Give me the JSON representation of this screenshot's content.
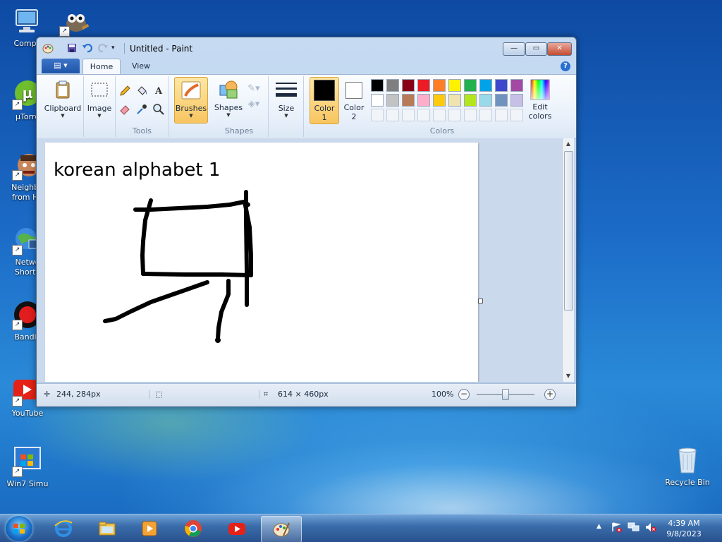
{
  "desktop": {
    "icons": [
      {
        "label": "Compu"
      },
      {
        "label": ""
      },
      {
        "label": "µTorre"
      },
      {
        "label": "Neighbo\nfrom He"
      },
      {
        "label": "Netwo\nShorto"
      },
      {
        "label": "Bandic"
      },
      {
        "label": "YouTube"
      },
      {
        "label": "Win7 Simu"
      },
      {
        "label": "Recycle Bin"
      }
    ]
  },
  "window": {
    "title": "Untitled - Paint",
    "caption_buttons": {
      "minimize": "—",
      "maximize": "▭",
      "close": "✕"
    }
  },
  "ribbon": {
    "tabs": [
      {
        "label": "Home"
      },
      {
        "label": "View"
      }
    ],
    "groups": {
      "clipboard": {
        "label": "Clipboard"
      },
      "image": {
        "label": "Image"
      },
      "tools": {
        "label": "Tools"
      },
      "brushes": {
        "label": "Brushes"
      },
      "shapes_btn": {
        "label": "Shapes"
      },
      "shapes_group": {
        "label": "Shapes"
      },
      "size": {
        "label": "Size"
      },
      "color1": {
        "label": "Color\n1"
      },
      "color2": {
        "label": "Color\n2"
      },
      "colors_group": {
        "label": "Colors"
      },
      "edit_colors": {
        "label": "Edit\ncolors"
      }
    },
    "palette_row1": [
      "#000000",
      "#7f7f7f",
      "#880015",
      "#ed1c24",
      "#ff7f27",
      "#fff200",
      "#22b14c",
      "#00a2e8",
      "#3f48cc",
      "#a349a4"
    ],
    "palette_row2": [
      "#ffffff",
      "#c3c3c3",
      "#b97a57",
      "#ffaec9",
      "#ffc90e",
      "#efe4b0",
      "#b5e61d",
      "#99d9ea",
      "#7092be",
      "#c8bfe7"
    ],
    "color1_value": "#000000",
    "color2_value": "#ffffff"
  },
  "canvas": {
    "text": "korean alphabet 1"
  },
  "status": {
    "cursor_pos": "244, 284px",
    "selection_size": "",
    "canvas_size": "614 × 460px",
    "zoom": "100%",
    "zoom_fraction": 0.5
  },
  "taskbar": {
    "apps": [
      {
        "name": "internet-explorer-icon"
      },
      {
        "name": "file-explorer-icon"
      },
      {
        "name": "media-player-icon"
      },
      {
        "name": "chrome-icon"
      },
      {
        "name": "youtube-icon"
      },
      {
        "name": "paint-icon",
        "active": true
      }
    ],
    "clock_time": "4:39 AM",
    "clock_date": "9/8/2023"
  }
}
